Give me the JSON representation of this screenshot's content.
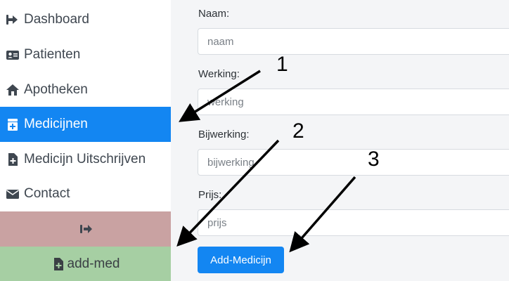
{
  "sidebar": {
    "items": [
      {
        "label": "Dashboard",
        "icon": "sign-in-icon"
      },
      {
        "label": "Patienten",
        "icon": "id-card-icon"
      },
      {
        "label": "Apotheken",
        "icon": "home-icon"
      },
      {
        "label": "Medicijnen",
        "icon": "medkit-icon",
        "active": true
      },
      {
        "label": "Medicijn Uitschrijven",
        "icon": "file-medical-icon"
      },
      {
        "label": "Contact",
        "icon": "envelope-icon"
      }
    ],
    "logout": {
      "label": "",
      "icon": "sign-out-icon",
      "color": "#c9a2a2"
    },
    "add_med": {
      "label": "add-med",
      "icon": "file-medical-icon",
      "color": "#a6cfa3"
    },
    "accent": "#1386f2"
  },
  "form": {
    "fields": [
      {
        "label": "Naam:",
        "placeholder": "naam"
      },
      {
        "label": "Werking:",
        "placeholder": "werking"
      },
      {
        "label": "Bijwerking:",
        "placeholder": "bijwerking"
      },
      {
        "label": "Prijs:",
        "placeholder": "prijs"
      }
    ],
    "submit_label": "Add-Medicijn"
  },
  "annotations": {
    "labels": [
      "1",
      "2",
      "3"
    ]
  }
}
